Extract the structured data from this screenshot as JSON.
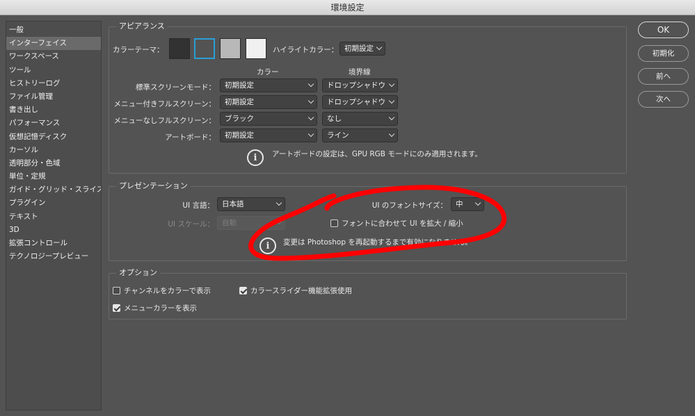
{
  "window": {
    "title": "環境設定"
  },
  "sidebar": {
    "items": [
      {
        "label": "一般"
      },
      {
        "label": "インターフェイス",
        "active": true
      },
      {
        "label": "ワークスペース"
      },
      {
        "label": "ツール"
      },
      {
        "label": "ヒストリーログ"
      },
      {
        "label": "ファイル管理"
      },
      {
        "label": "書き出し"
      },
      {
        "label": "パフォーマンス"
      },
      {
        "label": "仮想記憶ディスク"
      },
      {
        "label": "カーソル"
      },
      {
        "label": "透明部分・色域"
      },
      {
        "label": "単位・定規"
      },
      {
        "label": "ガイド・グリッド・スライス"
      },
      {
        "label": "プラグイン"
      },
      {
        "label": "テキスト"
      },
      {
        "label": "3D"
      },
      {
        "label": "拡張コントロール"
      },
      {
        "label": "テクノロジープレビュー"
      }
    ]
  },
  "appearance": {
    "title": "アピアランス",
    "color_theme_label": "カラーテーマ：",
    "highlight_label": "ハイライトカラー：",
    "highlight_value": "初期設定",
    "col_color": "カラー",
    "col_border": "境界線",
    "rows": [
      {
        "label": "標準スクリーンモード：",
        "color": "初期設定",
        "border": "ドロップシャドウ"
      },
      {
        "label": "メニュー付きフルスクリーン：",
        "color": "初期設定",
        "border": "ドロップシャドウ"
      },
      {
        "label": "メニューなしフルスクリーン：",
        "color": "ブラック",
        "border": "なし"
      },
      {
        "label": "アートボード：",
        "color": "初期設定",
        "border": "ライン"
      }
    ],
    "artboard_note": "アートボードの設定は、GPU RGB モードにのみ適用されます。",
    "theme_colors": [
      "#323232",
      "#535353",
      "#b8b8b8",
      "#f0f0f0"
    ],
    "selected_theme_border": "#2a9fd6"
  },
  "presentation": {
    "title": "プレゼンテーション",
    "ui_language_label": "UI 言語：",
    "ui_language_value": "日本語",
    "ui_scale_label": "UI スケール：",
    "ui_scale_value": "自動",
    "font_size_label": "UI のフォントサイズ：",
    "font_size_value": "中",
    "scale_with_font_label": "フォントに合わせて UI を拡大 / 縮小",
    "restart_note": "変更は Photoshop を再起動するまで有効になりません。"
  },
  "options": {
    "title": "オプション",
    "channels_in_color": "チャンネルをカラーで表示",
    "color_slider_ext": "カラースライダー機能拡張使用",
    "show_menu_colors": "メニューカラーを表示"
  },
  "buttons": {
    "ok": "OK",
    "reset": "初期化",
    "prev": "前へ",
    "next": "次へ"
  },
  "annotation_color": "#ff0000"
}
